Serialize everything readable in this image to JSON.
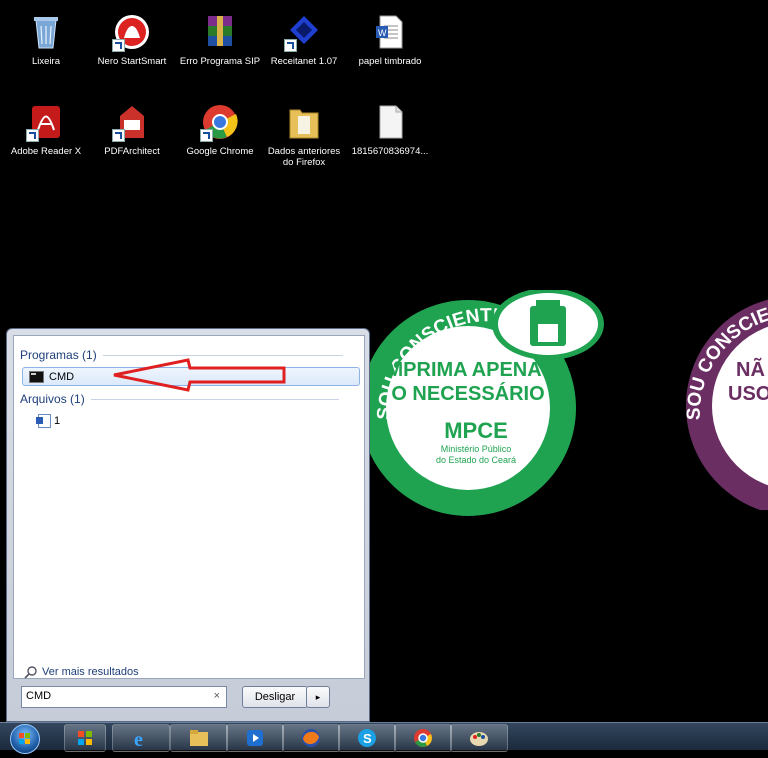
{
  "desktop": {
    "icons": [
      {
        "label": "Lixeira"
      },
      {
        "label": "Nero StartSmart"
      },
      {
        "label": "Erro Programa SIP"
      },
      {
        "label": "Receitanet 1.07"
      },
      {
        "label": "papel timbrado"
      },
      {
        "label": "Adobe Reader X"
      },
      {
        "label": "PDFArchitect"
      },
      {
        "label": "Google Chrome"
      },
      {
        "label": "Dados anteriores do Firefox"
      },
      {
        "label": "1815670836974..."
      }
    ]
  },
  "wallpaper": {
    "green_sticker": {
      "arc_text": "SOU CONSCIENTE",
      "line1": "IMPRIMA APENAS",
      "line2": "O NECESSÁRIO",
      "org": "MPCE",
      "org_sub1": "Ministério Público",
      "org_sub2": "do Estado do Ceará",
      "color": "#1fa351"
    },
    "purple_sticker": {
      "arc_text": "SOU CONSCIE",
      "line1": "NÃ",
      "line2": "USO",
      "color": "#6b2e63"
    }
  },
  "start_menu": {
    "programs_header": "Programas (1)",
    "program_result": "CMD",
    "files_header": "Arquivos (1)",
    "file_result": "1",
    "see_more": "Ver mais resultados",
    "search_value": "CMD",
    "clear_symbol": "×",
    "shutdown_label": "Desligar",
    "shutdown_arrow": "▸"
  },
  "taskbar": {
    "apps": [
      "start",
      "apps",
      "internet-explorer",
      "file-explorer",
      "media-player",
      "firefox",
      "skype",
      "chrome",
      "paint"
    ]
  }
}
